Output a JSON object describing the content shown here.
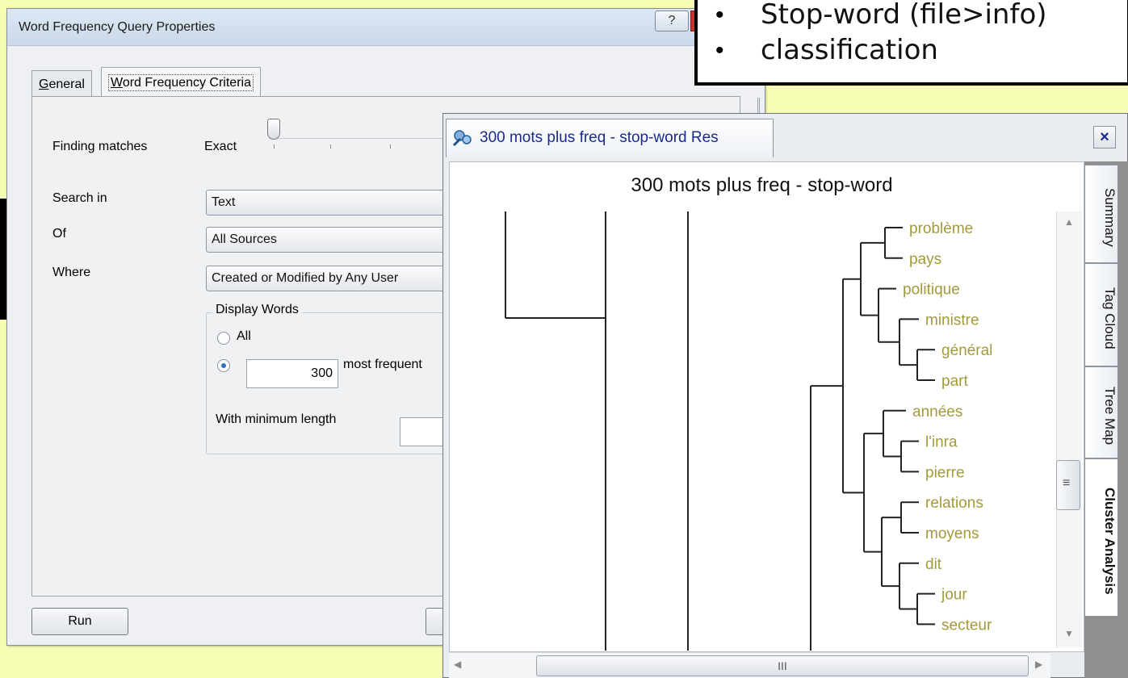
{
  "dialog": {
    "title": "Word Frequency Query Properties",
    "help_label": "?",
    "tabs": [
      {
        "label": "General",
        "accel": "G",
        "rest": "eneral",
        "selected": false
      },
      {
        "label": "Word Frequency Criteria",
        "accel": "W",
        "rest": "ord Frequency Criteria",
        "selected": true
      }
    ],
    "finding_matches_label": "Finding matches",
    "finding_matches_value": "Exact",
    "search_in_label": "Search in",
    "search_in_value": "Text",
    "of_label": "Of",
    "of_value": "All Sources",
    "where_label": "Where",
    "where_value": "Created or Modified by Any User",
    "display_words_label": "Display Words",
    "all_label": "All",
    "count_value": "300",
    "most_frequent_label": "most frequent",
    "min_length_label": "With minimum length",
    "run_label": "Run"
  },
  "notes": {
    "items": [
      "Stop-word (file>info)",
      "classification"
    ]
  },
  "results": {
    "tab_title": "300 mots plus freq - stop-word Res",
    "close_label": "×",
    "chart_title": "300 mots plus freq - stop-word",
    "side_tabs": [
      {
        "label": "Summary",
        "selected": false
      },
      {
        "label": "Tag Cloud",
        "selected": false
      },
      {
        "label": "Tree Map",
        "selected": false
      },
      {
        "label": "Cluster Analysis",
        "selected": true
      }
    ],
    "scroll_grip": "III",
    "vscroll_grip": "≡"
  },
  "chart_data": {
    "type": "dendrogram",
    "title": "300 mots plus freq - stop-word",
    "leaves": [
      "problème",
      "pays",
      "politique",
      "ministre",
      "général",
      "part",
      "années",
      "l'inra",
      "pierre",
      "relations",
      "moyens",
      "dit",
      "jour",
      "secteur"
    ],
    "tree": [
      [
        [
          "problème",
          "pays"
        ],
        [
          "politique",
          [
            "ministre",
            [
              "général",
              "part"
            ]
          ]
        ]
      ],
      [
        [
          "années",
          [
            "l'inra",
            "pierre"
          ]
        ],
        [
          [
            "relations",
            "moyens"
          ],
          [
            "dit",
            [
              "jour",
              "secteur"
            ]
          ]
        ]
      ]
    ],
    "colors": {
      "leaf_text": "#a39a3a",
      "lines": "#222222"
    }
  }
}
